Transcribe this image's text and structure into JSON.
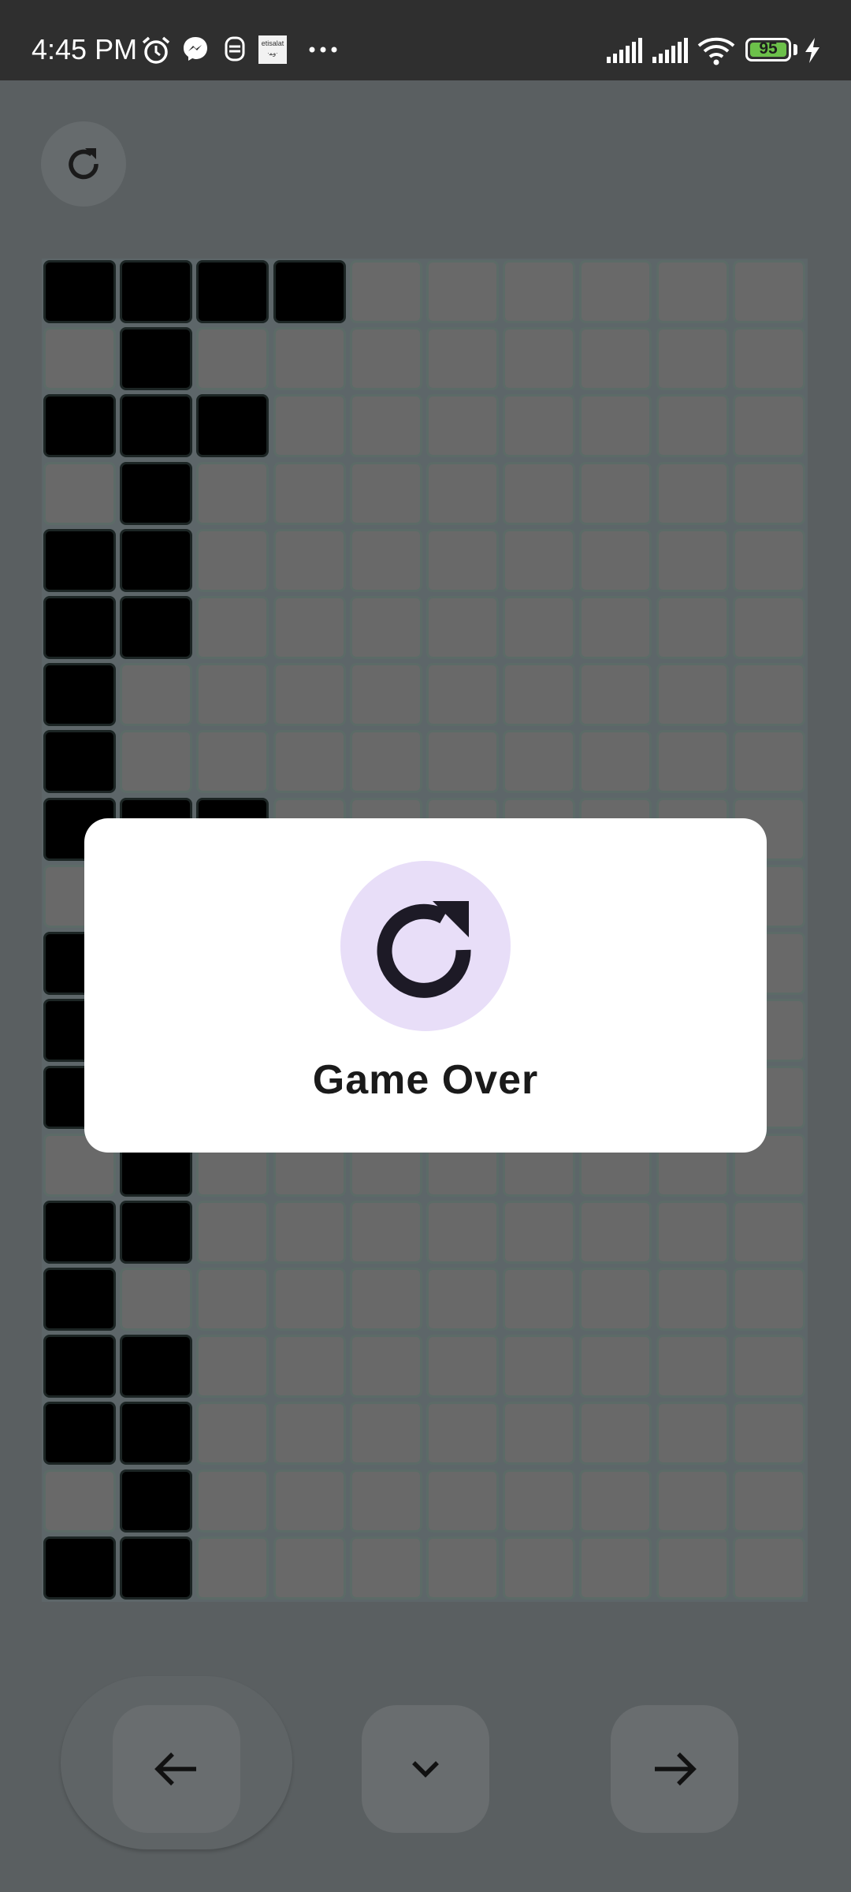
{
  "status_bar": {
    "time": "4:45 PM",
    "notification_icons": [
      "alarm-icon",
      "messenger-icon",
      "app-icon",
      "etisalat-icon",
      "more-dots-icon"
    ],
    "right_icons": [
      "signal-icon",
      "signal-icon",
      "wifi-icon",
      "battery-icon",
      "charging-icon"
    ],
    "battery_level": "95"
  },
  "toolbar": {
    "refresh_icon": "refresh-icon"
  },
  "board": {
    "rows": 20,
    "cols": 10,
    "filled": [
      [
        0,
        0
      ],
      [
        0,
        1
      ],
      [
        0,
        2
      ],
      [
        0,
        3
      ],
      [
        1,
        1
      ],
      [
        2,
        0
      ],
      [
        2,
        1
      ],
      [
        2,
        2
      ],
      [
        3,
        1
      ],
      [
        4,
        0
      ],
      [
        4,
        1
      ],
      [
        5,
        0
      ],
      [
        5,
        1
      ],
      [
        6,
        0
      ],
      [
        7,
        0
      ],
      [
        8,
        0
      ],
      [
        8,
        1
      ],
      [
        8,
        2
      ],
      [
        10,
        0
      ],
      [
        11,
        0
      ],
      [
        12,
        0
      ],
      [
        13,
        1
      ],
      [
        14,
        0
      ],
      [
        14,
        1
      ],
      [
        15,
        0
      ],
      [
        16,
        0
      ],
      [
        16,
        1
      ],
      [
        17,
        0
      ],
      [
        17,
        1
      ],
      [
        18,
        1
      ],
      [
        19,
        0
      ],
      [
        19,
        1
      ]
    ],
    "colors": {
      "empty": "#696969",
      "filled": "#000000"
    }
  },
  "dialog": {
    "icon": "restart-icon",
    "title": "Game Over",
    "icon_bg": "#e8def8"
  },
  "controls": {
    "left_icon": "arrow-left-icon",
    "down_icon": "chevron-down-icon",
    "right_icon": "arrow-right-icon"
  }
}
